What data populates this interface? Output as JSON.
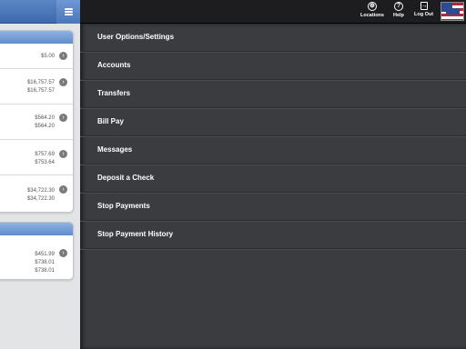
{
  "topbar": {
    "locations_label": "Locations",
    "help_label": "Help",
    "logout_label": "Log Out"
  },
  "accounts": {
    "group1": [
      {
        "amounts": [
          "$5.00"
        ]
      },
      {
        "amounts": [
          "$16,757.57",
          "$16,757.57"
        ]
      },
      {
        "amounts": [
          "$564.20",
          "$564.20"
        ]
      },
      {
        "amounts": [
          "$757.69",
          "$753.64"
        ]
      },
      {
        "amounts": [
          "$34,722.30",
          "$34,722.30"
        ]
      }
    ],
    "group2": [
      {
        "amounts": [
          "$451.99",
          "$738.01",
          "$738.01"
        ]
      }
    ]
  },
  "menu": {
    "items": [
      {
        "label": "User Options/Settings"
      },
      {
        "label": "Accounts"
      },
      {
        "label": "Transfers"
      },
      {
        "label": "Bill Pay"
      },
      {
        "label": "Messages"
      },
      {
        "label": "Deposit a Check"
      },
      {
        "label": "Stop Payments"
      },
      {
        "label": "Stop Payment History"
      }
    ]
  },
  "colors": {
    "header_blue": "#3d6aae",
    "menu_bg": "#3b3c40",
    "topbar_bg": "#1d1d1f"
  }
}
